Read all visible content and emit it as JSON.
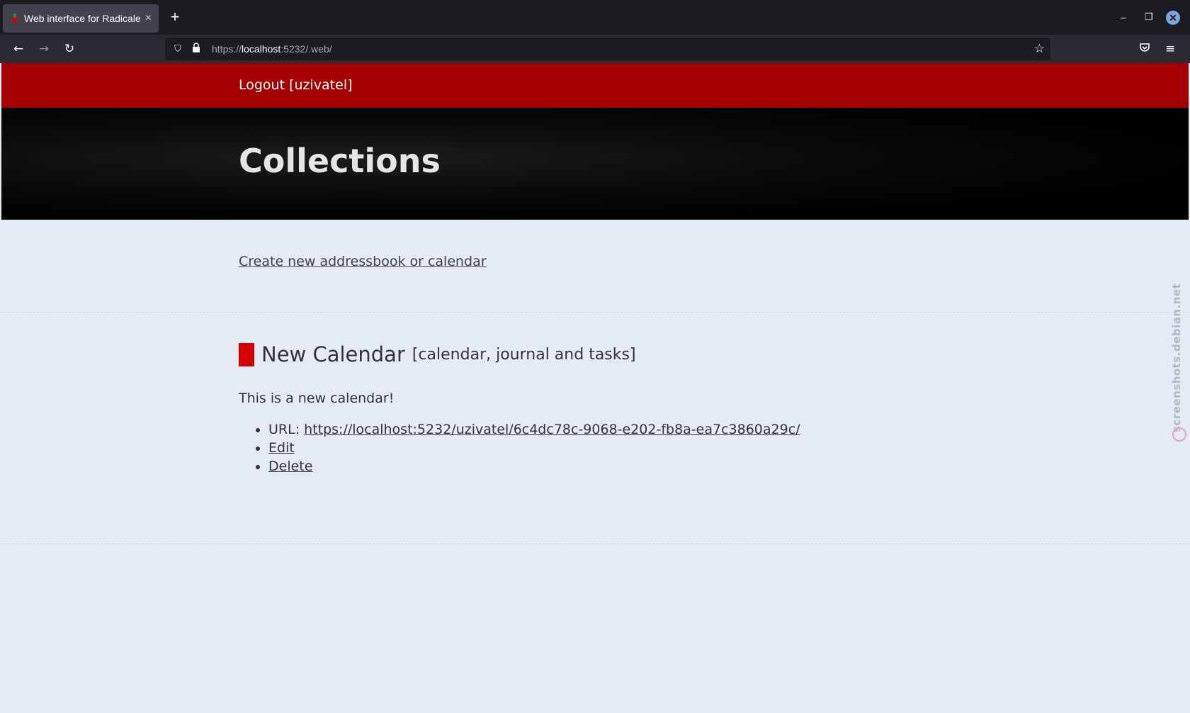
{
  "browser": {
    "tab_title": "Web interface for Radicale",
    "tab_close": "×",
    "new_tab": "+",
    "url_scheme": "https://",
    "url_host": "localhost",
    "url_rest": ":5232/.web/",
    "window_controls": {
      "minimize": "–",
      "maximize": "❐",
      "close": "✕"
    },
    "icons": {
      "back": "←",
      "forward": "→",
      "reload": "↻",
      "shield": "⛉",
      "lock": "🔒",
      "star": "☆",
      "pocket": "⛉",
      "menu": "≡"
    }
  },
  "page": {
    "logout_label": "Logout [uzivatel]",
    "title": "Collections",
    "create_link": "Create new addressbook or calendar",
    "collection": {
      "color": "#d40000",
      "name": "New Calendar",
      "kind": "[calendar, journal and tasks]",
      "description": "This is a new calendar!",
      "url_label": "URL: ",
      "url": "https://localhost:5232/uzivatel/6c4dc78c-9068-e202-fb8a-ea7c3860a29c/",
      "edit_label": "Edit",
      "delete_label": "Delete"
    },
    "watermark": "screenshots.debian.net"
  }
}
